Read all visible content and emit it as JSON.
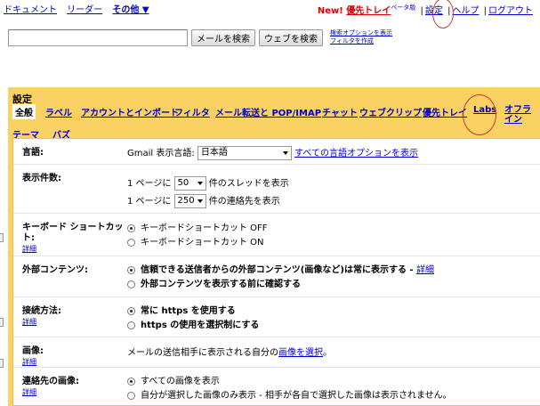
{
  "topnav": {
    "items": [
      "ドキュメント",
      "リーダー"
    ],
    "more": "その他 ▼"
  },
  "toplinks": {
    "new_label": "New!",
    "priority_label": "優先トレイ",
    "beta": "ベータ版",
    "settings": "設定",
    "help": "ヘルプ",
    "logout": "ログアウト"
  },
  "search": {
    "value": "",
    "mail_button": "メールを検索",
    "web_button": "ウェブを検索",
    "opt1": "検索オプションを表示",
    "opt2": "フィルタを作成"
  },
  "settings": {
    "title": "設定",
    "tabs": [
      "全般",
      "ラベル",
      "アカウントとインポート",
      "フィルタ",
      "メール転送と POP/IMAP",
      "チャット",
      "ウェブクリップ",
      "優先トレイ",
      "Labs",
      "オフラ",
      "イン",
      "テーマ",
      "バズ"
    ],
    "language": {
      "label": "言語:",
      "prefix": "Gmail 表示言語:",
      "value": "日本語",
      "link": "すべての言語オプションを表示"
    },
    "page_size": {
      "label": "表示件数:",
      "pre1": "1 ページに",
      "val1": "50",
      "post1": "件のスレッドを表示",
      "pre2": "1 ページに",
      "val2": "250",
      "post2": "件の連絡先を表示"
    },
    "shortcuts": {
      "label": "キーボード ショートカット:",
      "detail": "詳細",
      "opt_off": "キーボードショートカット OFF",
      "opt_on": "キーボードショートカット ON"
    },
    "external": {
      "label": "外部コンテンツ:",
      "opt1": "信頼できる送信者からの外部コンテンツ(画像など)は常に表示する -",
      "opt1_link": "詳細",
      "opt2": "外部コンテンツを表示する前に確認する"
    },
    "connection": {
      "label": "接続方法:",
      "detail": "詳細",
      "opt1": "常に https を使用する",
      "opt2": "https の使用を選択制にする"
    },
    "picture": {
      "label": "画像:",
      "detail": "詳細",
      "text": "メールの送信相手に表示される自分の",
      "link": "画像を選択",
      "end": "。"
    },
    "contact_pics": {
      "label": "連絡先の画像:",
      "detail": "詳細",
      "opt1": "すべての画像を表示",
      "opt2": "自分が選択した画像のみ表示 - 相手が各自で選択した画像は表示されません。"
    }
  }
}
